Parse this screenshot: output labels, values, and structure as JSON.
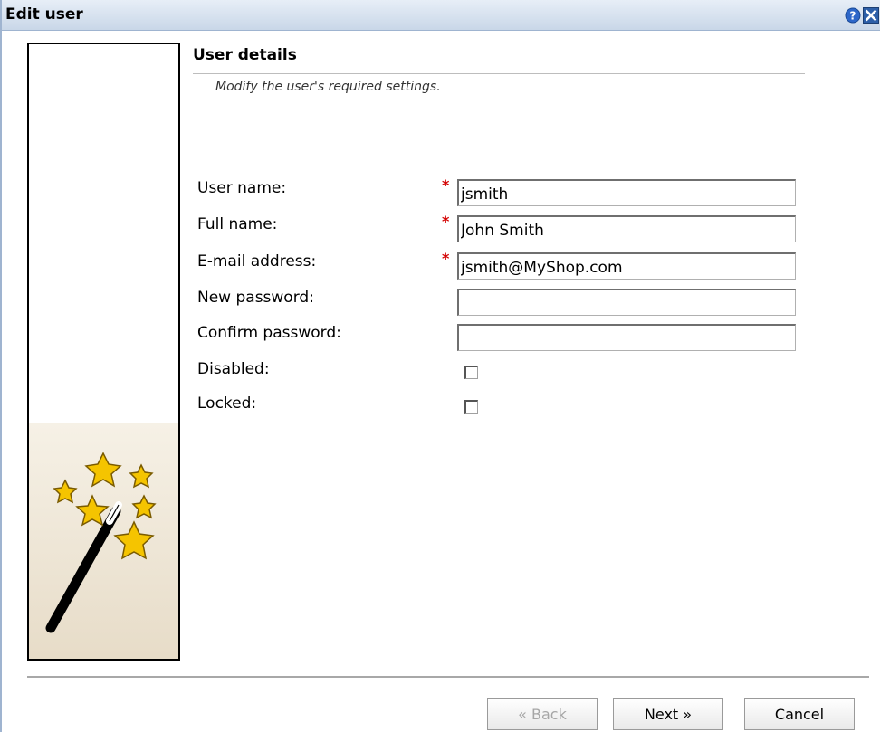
{
  "dialog": {
    "title": "Edit user",
    "help_icon": "question-mark-icon",
    "close_icon": "close-x-icon"
  },
  "section": {
    "title": "User details",
    "subtitle": "Modify the user's required settings."
  },
  "form": {
    "required_marker": "*",
    "fields": {
      "username": {
        "label": "User name:",
        "value": "jsmith",
        "required": true
      },
      "fullname": {
        "label": "Full name:",
        "value": "John Smith",
        "required": true
      },
      "email": {
        "label": "E-mail address:",
        "value": "jsmith@MyShop.com",
        "required": true
      },
      "new_password": {
        "label": "New password:",
        "value": "",
        "required": false
      },
      "confirm_password": {
        "label": "Confirm password:",
        "value": "",
        "required": false
      }
    },
    "checkboxes": {
      "disabled": {
        "label": "Disabled:",
        "checked": false
      },
      "locked": {
        "label": "Locked:",
        "checked": false
      }
    }
  },
  "buttons": {
    "back": {
      "label": "« Back",
      "enabled": false
    },
    "next": {
      "label": "Next »",
      "enabled": true
    },
    "cancel": {
      "label": "Cancel",
      "enabled": true
    }
  },
  "illustration": "magic-wand-stars-icon",
  "colors": {
    "required": "#d30000",
    "titlebar": "#c9d7e8",
    "help_icon": "#2d67c9",
    "close_icon": "#2d5fa8"
  }
}
